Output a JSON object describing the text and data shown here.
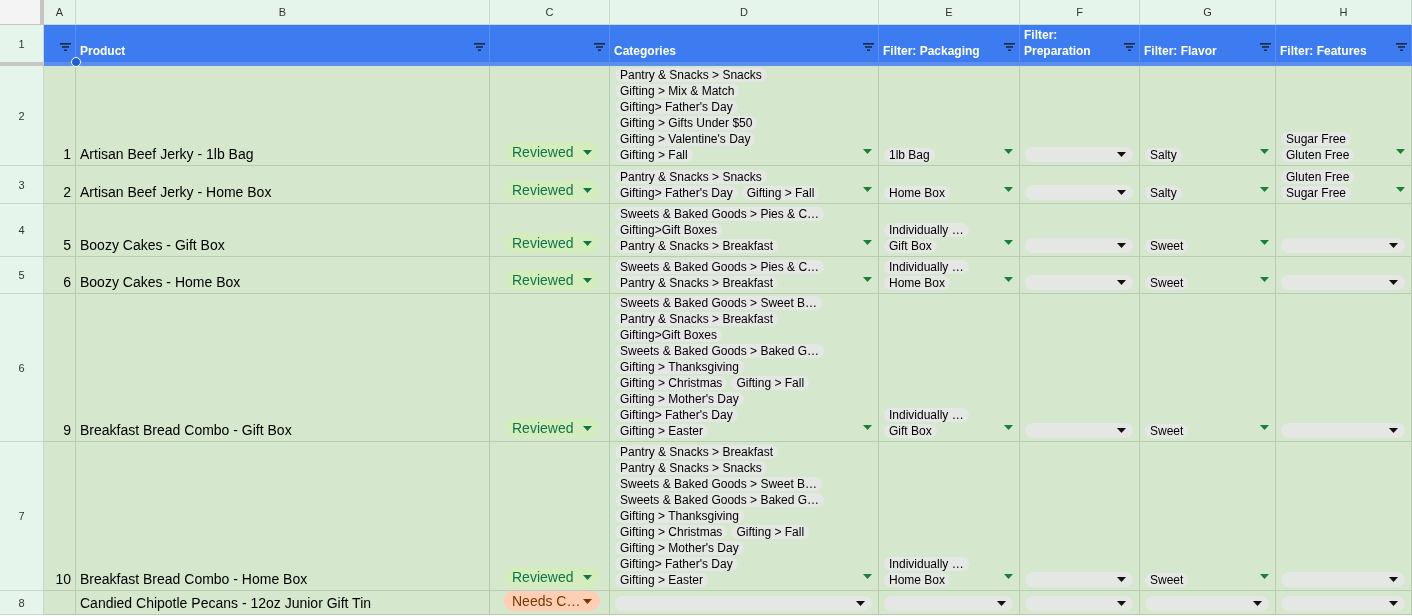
{
  "column_letters": [
    "A",
    "B",
    "C",
    "D",
    "E",
    "F",
    "G",
    "H"
  ],
  "row_numbers": [
    "1",
    "2",
    "3",
    "4",
    "5",
    "6",
    "7",
    "8"
  ],
  "header": [
    {
      "filter": true
    },
    {
      "label": "Product",
      "filter": true
    },
    {
      "filter": true
    },
    {
      "label": "Categories",
      "filter": true
    },
    {
      "label": "Filter: Packaging",
      "filter": true
    },
    {
      "label": "Filter: Preparation",
      "filter": true
    },
    {
      "label": "Filter: Flavor",
      "filter": true
    },
    {
      "label": "Filter: Features",
      "filter": true
    }
  ],
  "rows": [
    {
      "index": "1",
      "product": "Artisan Beef Jerky - 1lb Bag",
      "status": {
        "label": "Reviewed",
        "kind": "done",
        "color": "#d4edbc"
      },
      "categories": [
        "Pantry & Snacks > Snacks",
        "Gifting > Mix & Match",
        "Gifting> Father's Day",
        "Gifting > Gifts Under $50",
        "Gifting > Valentine's Day",
        "Gifting > Fall"
      ],
      "packaging": [
        "1lb Bag"
      ],
      "flavor": [
        "Salty"
      ],
      "features": [
        "Sugar Free",
        "Gluten Free"
      ]
    },
    {
      "index": "2",
      "product": "Artisan Beef Jerky - Home Box",
      "status": {
        "label": "Reviewed",
        "kind": "done",
        "color": "#d4edbc"
      },
      "categories": [
        "Pantry & Snacks > Snacks",
        "Gifting> Father's Day",
        "Gifting > Fall"
      ],
      "packaging": [
        "Home Box"
      ],
      "flavor": [
        "Salty"
      ],
      "features": [
        "Gluten Free",
        "Sugar Free"
      ]
    },
    {
      "index": "5",
      "product": "Boozy Cakes - Gift Box",
      "status": {
        "label": "Reviewed",
        "kind": "done",
        "color": "#d4edbc"
      },
      "categories": [
        "Sweets & Baked Goods > Pies & C…",
        "Gifting>Gift Boxes",
        "Pantry & Snacks > Breakfast"
      ],
      "packaging": [
        "Individually …",
        "Gift Box"
      ],
      "flavor": [
        "Sweet"
      ]
    },
    {
      "index": "6",
      "product": "Boozy Cakes - Home Box",
      "status": {
        "label": "Reviewed",
        "kind": "done",
        "color": "#d4edbc"
      },
      "categories": [
        "Sweets & Baked Goods > Pies & C…",
        "Pantry & Snacks > Breakfast"
      ],
      "packaging": [
        "Individually …",
        "Home Box"
      ],
      "flavor": [
        "Sweet"
      ]
    },
    {
      "index": "9",
      "product": "Breakfast Bread Combo - Gift Box",
      "status": {
        "label": "Reviewed",
        "kind": "done",
        "color": "#d4edbc"
      },
      "categories": [
        "Sweets & Baked Goods > Sweet B…",
        "Pantry & Snacks > Breakfast",
        "Gifting>Gift Boxes",
        "Sweets & Baked Goods > Baked G…",
        "Gifting > Thanksgiving",
        "Gifting > Christmas",
        "Gifting > Fall",
        "Gifting > Mother's Day",
        "Gifting> Father's Day",
        "Gifting > Easter"
      ],
      "packaging": [
        "Individually …",
        "Gift Box"
      ],
      "flavor": [
        "Sweet"
      ]
    },
    {
      "index": "10",
      "product": "Breakfast Bread Combo - Home Box",
      "status": {
        "label": "Reviewed",
        "kind": "done",
        "color": "#d4edbc"
      },
      "categories": [
        "Pantry & Snacks > Breakfast",
        "Pantry & Snacks > Snacks",
        "Sweets & Baked Goods > Sweet B…",
        "Sweets & Baked Goods > Baked G…",
        "Gifting > Thanksgiving",
        "Gifting > Christmas",
        "Gifting > Fall",
        "Gifting > Mother's Day",
        "Gifting> Father's Day",
        "Gifting > Easter"
      ],
      "packaging": [
        "Individually …",
        "Home Box"
      ],
      "flavor": [
        "Sweet"
      ]
    },
    {
      "product": "Candied Chipotle Pecans - 12oz Junior Gift Tin",
      "status": {
        "label": "Needs C…",
        "kind": "todo",
        "color": "#ffcfb5"
      }
    }
  ]
}
